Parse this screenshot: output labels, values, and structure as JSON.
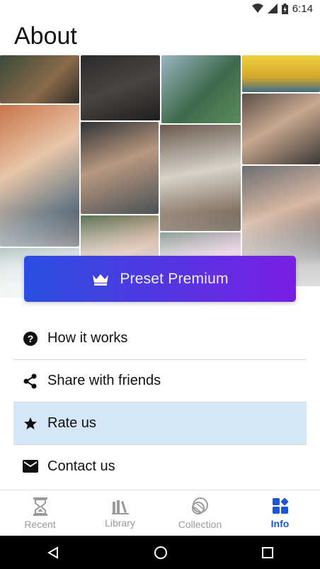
{
  "status_bar": {
    "time": "6:14"
  },
  "header": {
    "title": "About"
  },
  "premium": {
    "label": "Preset Premium",
    "icon": "crown-icon",
    "gradient_start": "#2a4fe0",
    "gradient_end": "#7a1fe2"
  },
  "menu": {
    "items": [
      {
        "label": "How it works",
        "icon": "help-circle-icon"
      },
      {
        "label": "Share with friends",
        "icon": "share-icon"
      },
      {
        "label": "Rate us",
        "icon": "star-icon"
      },
      {
        "label": "Contact us",
        "icon": "mail-icon"
      }
    ]
  },
  "bottom_nav": {
    "items": [
      {
        "label": "Recent",
        "icon": "hourglass-icon"
      },
      {
        "label": "Library",
        "icon": "library-icon"
      },
      {
        "label": "Collection",
        "icon": "collection-icon"
      },
      {
        "label": "Info",
        "icon": "info-grid-icon"
      }
    ],
    "active": "Info",
    "active_color": "#1a56d8"
  }
}
